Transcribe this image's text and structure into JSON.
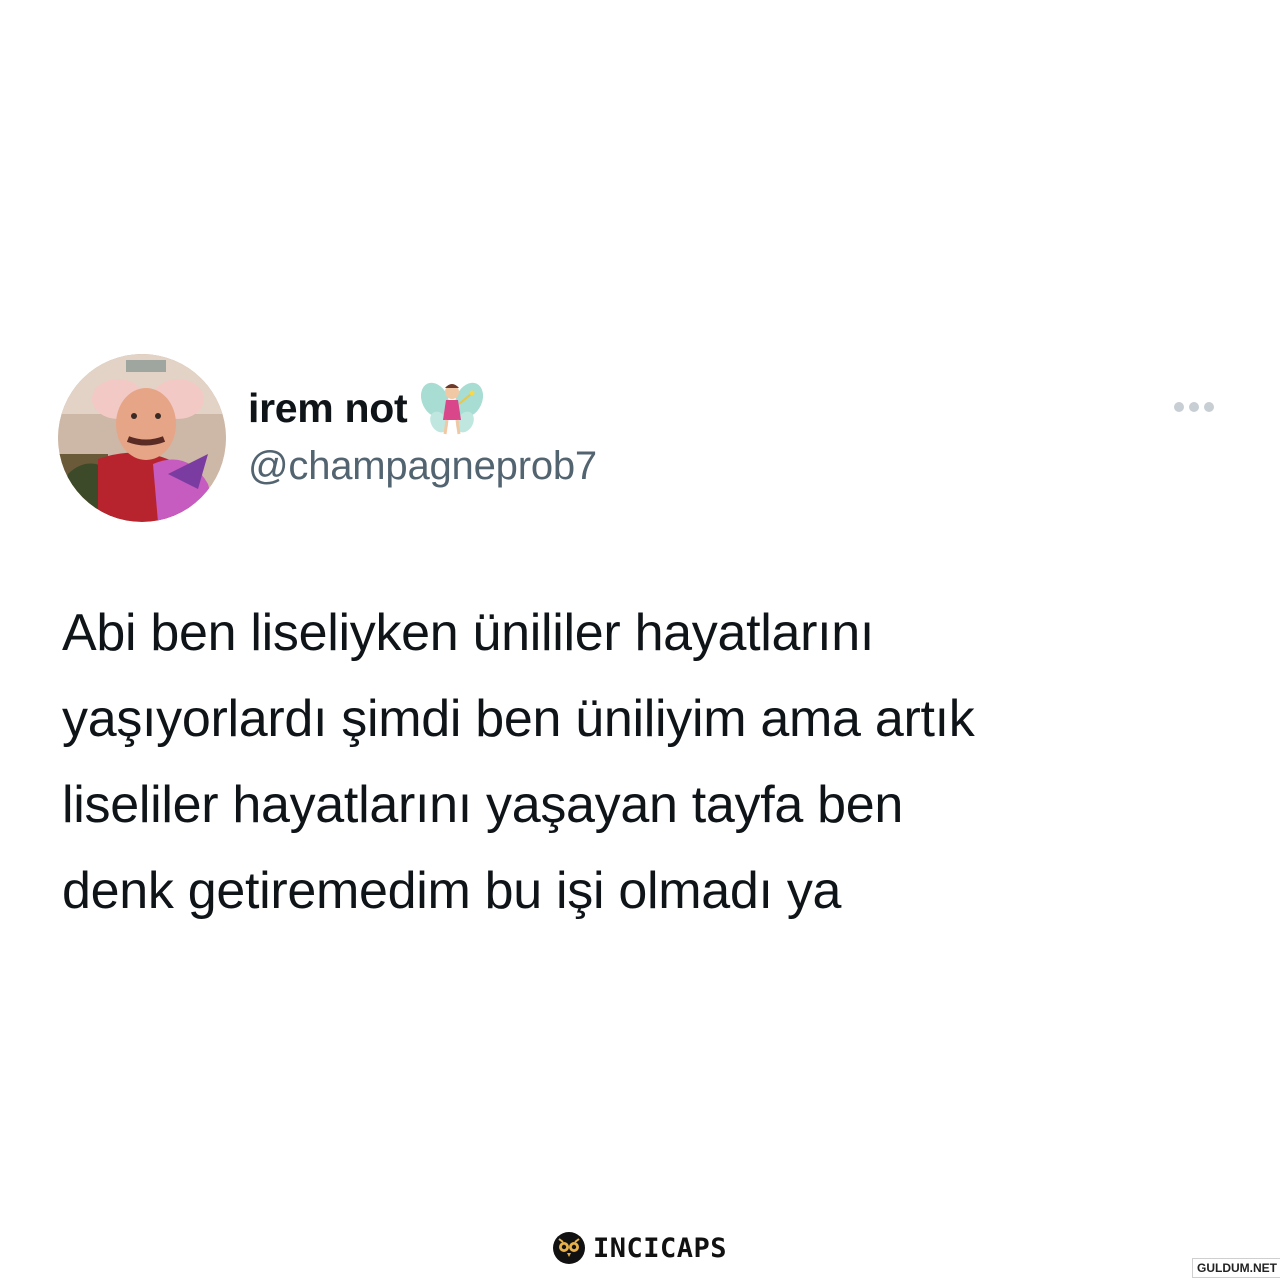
{
  "tweet": {
    "display_name": "irem not",
    "name_emoji": "fairy-icon",
    "handle": "@champagneprob7",
    "more_icon": "more-horizontal-icon",
    "text": "Abi ben liseliyken ünililer hayatlarını\nyaşıyorlardı şimdi ben üniliyim ama artık\nliseliler hayatlarını yaşayan tayfa ben\ndenk getiremedim bu işi olmadı ya"
  },
  "avatar": {
    "icon": "avatar",
    "alt": "profile photo"
  },
  "brand": {
    "icon": "owl-icon",
    "name": "INCICAPS"
  },
  "watermark": {
    "text": "GULDUM.NET"
  },
  "colors": {
    "background": "#ffffff",
    "text_primary": "#0f1419",
    "text_secondary": "#536471"
  }
}
